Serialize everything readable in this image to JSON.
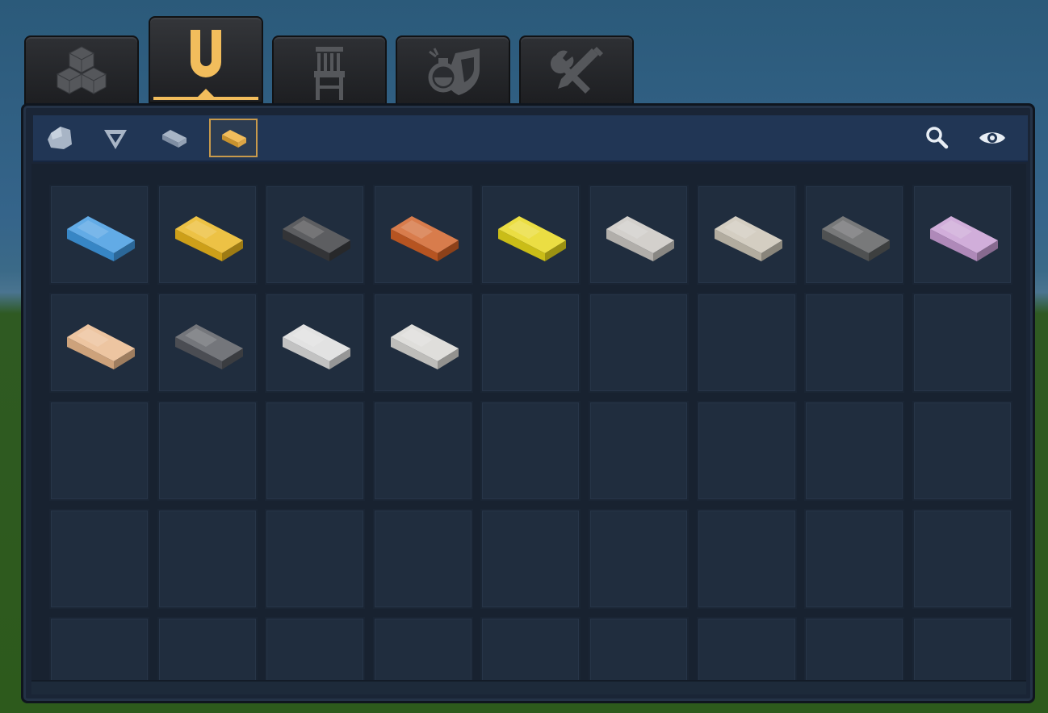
{
  "tabs": [
    {
      "id": "blocks",
      "icon": "cubes-icon",
      "active": false
    },
    {
      "id": "items",
      "icon": "magnet-icon",
      "active": true
    },
    {
      "id": "furniture",
      "icon": "chair-icon",
      "active": false
    },
    {
      "id": "potions",
      "icon": "potion-shield-icon",
      "active": false
    },
    {
      "id": "tools",
      "icon": "tools-icon",
      "active": false
    }
  ],
  "subtabs": [
    {
      "id": "ores",
      "icon": "ore-chunk-icon",
      "active": false
    },
    {
      "id": "gems",
      "icon": "gem-icon",
      "active": false
    },
    {
      "id": "raw-bars",
      "icon": "raw-bar-icon",
      "active": false
    },
    {
      "id": "ingots",
      "icon": "ingot-icon",
      "active": true
    }
  ],
  "toolbar": [
    {
      "id": "search",
      "icon": "search-icon"
    },
    {
      "id": "visibility",
      "icon": "eye-icon"
    }
  ],
  "ingots": [
    {
      "icon": "blue-ingot-icon",
      "color": "#3f98e0"
    },
    {
      "icon": "gold-ingot-icon",
      "color": "#e9b51c"
    },
    {
      "icon": "dark-ingot-icon",
      "color": "#3a3b3e"
    },
    {
      "icon": "copper-ingot-icon",
      "color": "#cf5f25"
    },
    {
      "icon": "yellow-ingot-icon",
      "color": "#e6d71a"
    },
    {
      "icon": "silver-ingot-icon",
      "color": "#c9c6c1"
    },
    {
      "icon": "pale-ingot-icon",
      "color": "#cac3b5"
    },
    {
      "icon": "graphite-ingot-icon",
      "color": "#5a5c5d"
    },
    {
      "icon": "pink-ingot-icon",
      "color": "#c79cd2"
    },
    {
      "icon": "peach-ingot-icon",
      "color": "#e9b88c"
    },
    {
      "icon": "steel-ingot-icon",
      "color": "#55585e"
    },
    {
      "icon": "white-ingot-icon",
      "color": "#dcdcdc"
    },
    {
      "icon": "light-ingot-icon",
      "color": "#d8d7d3"
    }
  ],
  "grid": {
    "columns": 9,
    "rows": 5
  },
  "colors": {
    "accent": "#f2bd5c",
    "panel": "#1a2536",
    "subbar": "#213655"
  }
}
